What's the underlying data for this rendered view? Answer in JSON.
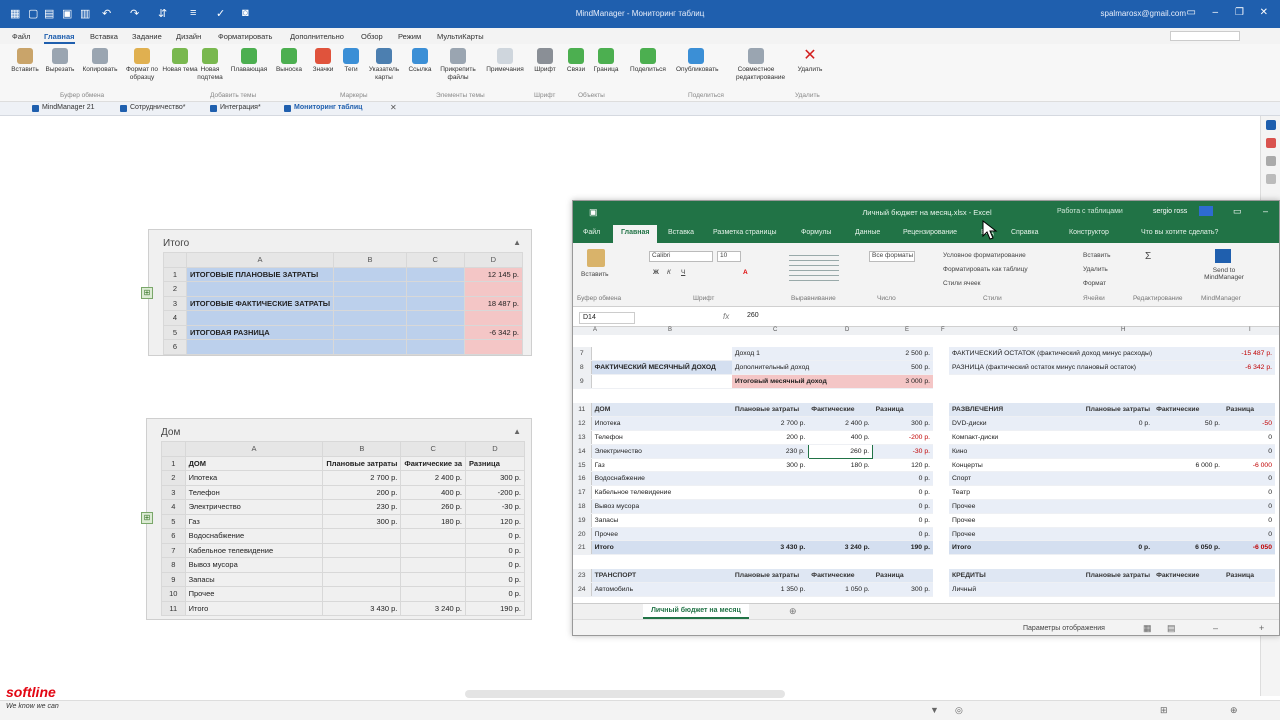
{
  "titlebar": {
    "title": "MindManager - Мониторинг таблиц",
    "user": "spalmarosx@gmail.com"
  },
  "menu": [
    "Файл",
    "Главная",
    "Вставка",
    "Задание",
    "Дизайн",
    "Форматировать",
    "Дополнительно",
    "Обзор",
    "Режим",
    "МультиКарты"
  ],
  "menu_active": "Главная",
  "ribbon": {
    "buttons": [
      "Вставить",
      "Вырезать",
      "Копировать",
      "Формат по образцу",
      "Новая тема",
      "Новая подтема",
      "Плавающая",
      "Выноска",
      "Значки",
      "Теги",
      "Указатель карты",
      "Ссылка",
      "Прикрепить файлы",
      "Примечания",
      "Шрифт",
      "Связи",
      "Граница",
      "Поделиться",
      "Опубликовать",
      "Совместное редактирование",
      "Удалить"
    ],
    "groups": [
      "Буфер обмена",
      "Добавить темы",
      "Маркеры",
      "Элементы темы",
      "Шрифт",
      "Объекты",
      "Поделиться",
      "Удалить"
    ]
  },
  "doc_tabs": [
    "MindManager 21",
    "Сотрудничество*",
    "Интеграция*",
    "Мониторинг таблиц"
  ],
  "itogo_topic": {
    "title": "Итого",
    "columns": [
      "A",
      "B",
      "C",
      "D"
    ],
    "rows": [
      {
        "n": "1",
        "a": "ИТОГОВЫЕ ПЛАНОВЫЕ ЗАТРАТЫ",
        "d": "12 145 р."
      },
      {
        "n": "2",
        "a": "",
        "d": ""
      },
      {
        "n": "3",
        "a": "ИТОГОВЫЕ ФАКТИЧЕСКИЕ ЗАТРАТЫ",
        "d": "18 487 р."
      },
      {
        "n": "4",
        "a": "",
        "d": ""
      },
      {
        "n": "5",
        "a": "ИТОГОВАЯ РАЗНИЦА",
        "d": "-6 342 р."
      },
      {
        "n": "6",
        "a": "",
        "d": ""
      }
    ]
  },
  "dom_topic": {
    "title": "Дом",
    "columns": [
      "A",
      "B",
      "C",
      "D"
    ],
    "rows": [
      {
        "n": "1",
        "a": "ДОМ",
        "b": "Плановые затраты",
        "c": "Фактические за",
        "d": "Разница"
      },
      {
        "n": "2",
        "a": "Ипотека",
        "b": "2 700 р.",
        "c": "2 400 р.",
        "d": "300 р."
      },
      {
        "n": "3",
        "a": "Телефон",
        "b": "200 р.",
        "c": "400 р.",
        "d": "-200 р."
      },
      {
        "n": "4",
        "a": "Электричество",
        "b": "230 р.",
        "c": "260 р.",
        "d": "-30 р."
      },
      {
        "n": "5",
        "a": "Газ",
        "b": "300 р.",
        "c": "180 р.",
        "d": "120 р."
      },
      {
        "n": "6",
        "a": "Водоснабжение",
        "b": "",
        "c": "",
        "d": "0 р."
      },
      {
        "n": "7",
        "a": "Кабельное телевидение",
        "b": "",
        "c": "",
        "d": "0 р."
      },
      {
        "n": "8",
        "a": "Вывоз мусора",
        "b": "",
        "c": "",
        "d": "0 р."
      },
      {
        "n": "9",
        "a": "Запасы",
        "b": "",
        "c": "",
        "d": "0 р."
      },
      {
        "n": "10",
        "a": "Прочее",
        "b": "",
        "c": "",
        "d": "0 р."
      },
      {
        "n": "11",
        "a": "Итого",
        "b": "3 430 р.",
        "c": "3 240 р.",
        "d": "190 р."
      }
    ]
  },
  "excel": {
    "title": "Личный бюджет на месяц.xlsx - Excel",
    "tools_label": "Работа с таблицами",
    "user": "sergio ross",
    "tabs": [
      "Файл",
      "Главная",
      "Вставка",
      "Разметка страницы",
      "Формулы",
      "Данные",
      "Рецензирование",
      "Вид",
      "Справка",
      "Конструктор",
      "Что вы хотите сделать?"
    ],
    "ribbon": {
      "paste": "Вставить",
      "font_name": "Calibri",
      "font_size": "10",
      "number_format": "Все форматы",
      "cond_format": "Условное форматирование",
      "format_table": "Форматировать как таблицу",
      "cell_styles": "Стили ячеек",
      "insert": "Вставить",
      "delete": "Удалить",
      "format": "Формат",
      "send": "Send to MindManager",
      "groups": [
        "Буфер обмена",
        "Шрифт",
        "Выравнивание",
        "Число",
        "Стили",
        "Ячейки",
        "Редактирование",
        "MindManager"
      ]
    },
    "name_box": "D14",
    "formula": "260",
    "col_headers": [
      "A",
      "B",
      "C",
      "D",
      "E",
      "F",
      "G",
      "H",
      "I"
    ],
    "income": [
      {
        "row": "7",
        "label": "",
        "sub": "Доход 1",
        "val": "2 500 р."
      },
      {
        "row": "8",
        "label": "ФАКТИЧЕСКИЙ МЕСЯЧНЫЙ ДОХОД",
        "sub": "Дополнительный доход",
        "val": "500 р."
      },
      {
        "row": "9",
        "label": "",
        "sub": "Итоговый месячный доход",
        "val": "3 000 р."
      }
    ],
    "income_right": [
      {
        "text": "ФАКТИЧЕСКИЙ ОСТАТОК (фактический доход минус расходы)",
        "val": "-15 487 р."
      },
      {
        "text": "РАЗНИЦА (фактический остаток минус плановый остаток)",
        "val": "-6 342 р."
      }
    ],
    "dom_header": [
      "ДОМ",
      "Плановые затраты",
      "Фактические",
      "Разница"
    ],
    "dom_rows": [
      {
        "row": "12",
        "a": "Ипотека",
        "b": "2 700 р.",
        "c": "2 400 р.",
        "d": "300 р."
      },
      {
        "row": "13",
        "a": "Телефон",
        "b": "200 р.",
        "c": "400 р.",
        "d": "-200 р."
      },
      {
        "row": "14",
        "a": "Электричество",
        "b": "230 р.",
        "c": "260 р.",
        "d": "-30 р."
      },
      {
        "row": "15",
        "a": "Газ",
        "b": "300 р.",
        "c": "180 р.",
        "d": "120 р."
      },
      {
        "row": "16",
        "a": "Водоснабжение",
        "b": "",
        "c": "",
        "d": "0 р."
      },
      {
        "row": "17",
        "a": "Кабельное телевидение",
        "b": "",
        "c": "",
        "d": "0 р."
      },
      {
        "row": "18",
        "a": "Вывоз мусора",
        "b": "",
        "c": "",
        "d": "0 р."
      },
      {
        "row": "19",
        "a": "Запасы",
        "b": "",
        "c": "",
        "d": "0 р."
      },
      {
        "row": "20",
        "a": "Прочее",
        "b": "",
        "c": "",
        "d": "0 р."
      },
      {
        "row": "21",
        "a": "Итого",
        "b": "3 430 р.",
        "c": "3 240 р.",
        "d": "190 р."
      }
    ],
    "fun_header": [
      "РАЗВЛЕЧЕНИЯ",
      "Плановые затраты",
      "Фактические",
      "Разница"
    ],
    "fun_rows": [
      {
        "a": "DVD-диски",
        "b": "0 р.",
        "c": "50 р.",
        "d": "-50"
      },
      {
        "a": "Компакт-диски",
        "b": "",
        "c": "",
        "d": "0"
      },
      {
        "a": "Кино",
        "b": "",
        "c": "",
        "d": "0"
      },
      {
        "a": "Концерты",
        "b": "",
        "c": "6 000 р.",
        "d": "-6 000"
      },
      {
        "a": "Спорт",
        "b": "",
        "c": "",
        "d": "0"
      },
      {
        "a": "Театр",
        "b": "",
        "c": "",
        "d": "0"
      },
      {
        "a": "Прочее",
        "b": "",
        "c": "",
        "d": "0"
      },
      {
        "a": "Прочее",
        "b": "",
        "c": "",
        "d": "0"
      },
      {
        "a": "Прочее",
        "b": "",
        "c": "",
        "d": "0"
      },
      {
        "a": "Итого",
        "b": "0 р.",
        "c": "6 050 р.",
        "d": "-6 050"
      }
    ],
    "transport_header": [
      "ТРАНСПОРТ",
      "Плановые затраты",
      "Фактические",
      "Разница"
    ],
    "transport_rows": [
      {
        "row": "24",
        "a": "Автомобиль",
        "b": "1 350 р.",
        "c": "1 050 р.",
        "d": "300 р."
      }
    ],
    "credit_header": [
      "КРЕДИТЫ",
      "Плановые затраты",
      "Фактические",
      "Разница"
    ],
    "credit_rows": [
      {
        "a": "Личный"
      }
    ],
    "sheet_tab": "Личный бюджет на месяц",
    "status": "Параметры отображения"
  },
  "brand": {
    "name": "softline",
    "tagline": "We know we can"
  },
  "colors": {
    "mm_blue": "#1f5fae",
    "excel_green": "#217346",
    "cell_blue": "#bcd0ec",
    "cell_pink": "#f4c6c6"
  }
}
